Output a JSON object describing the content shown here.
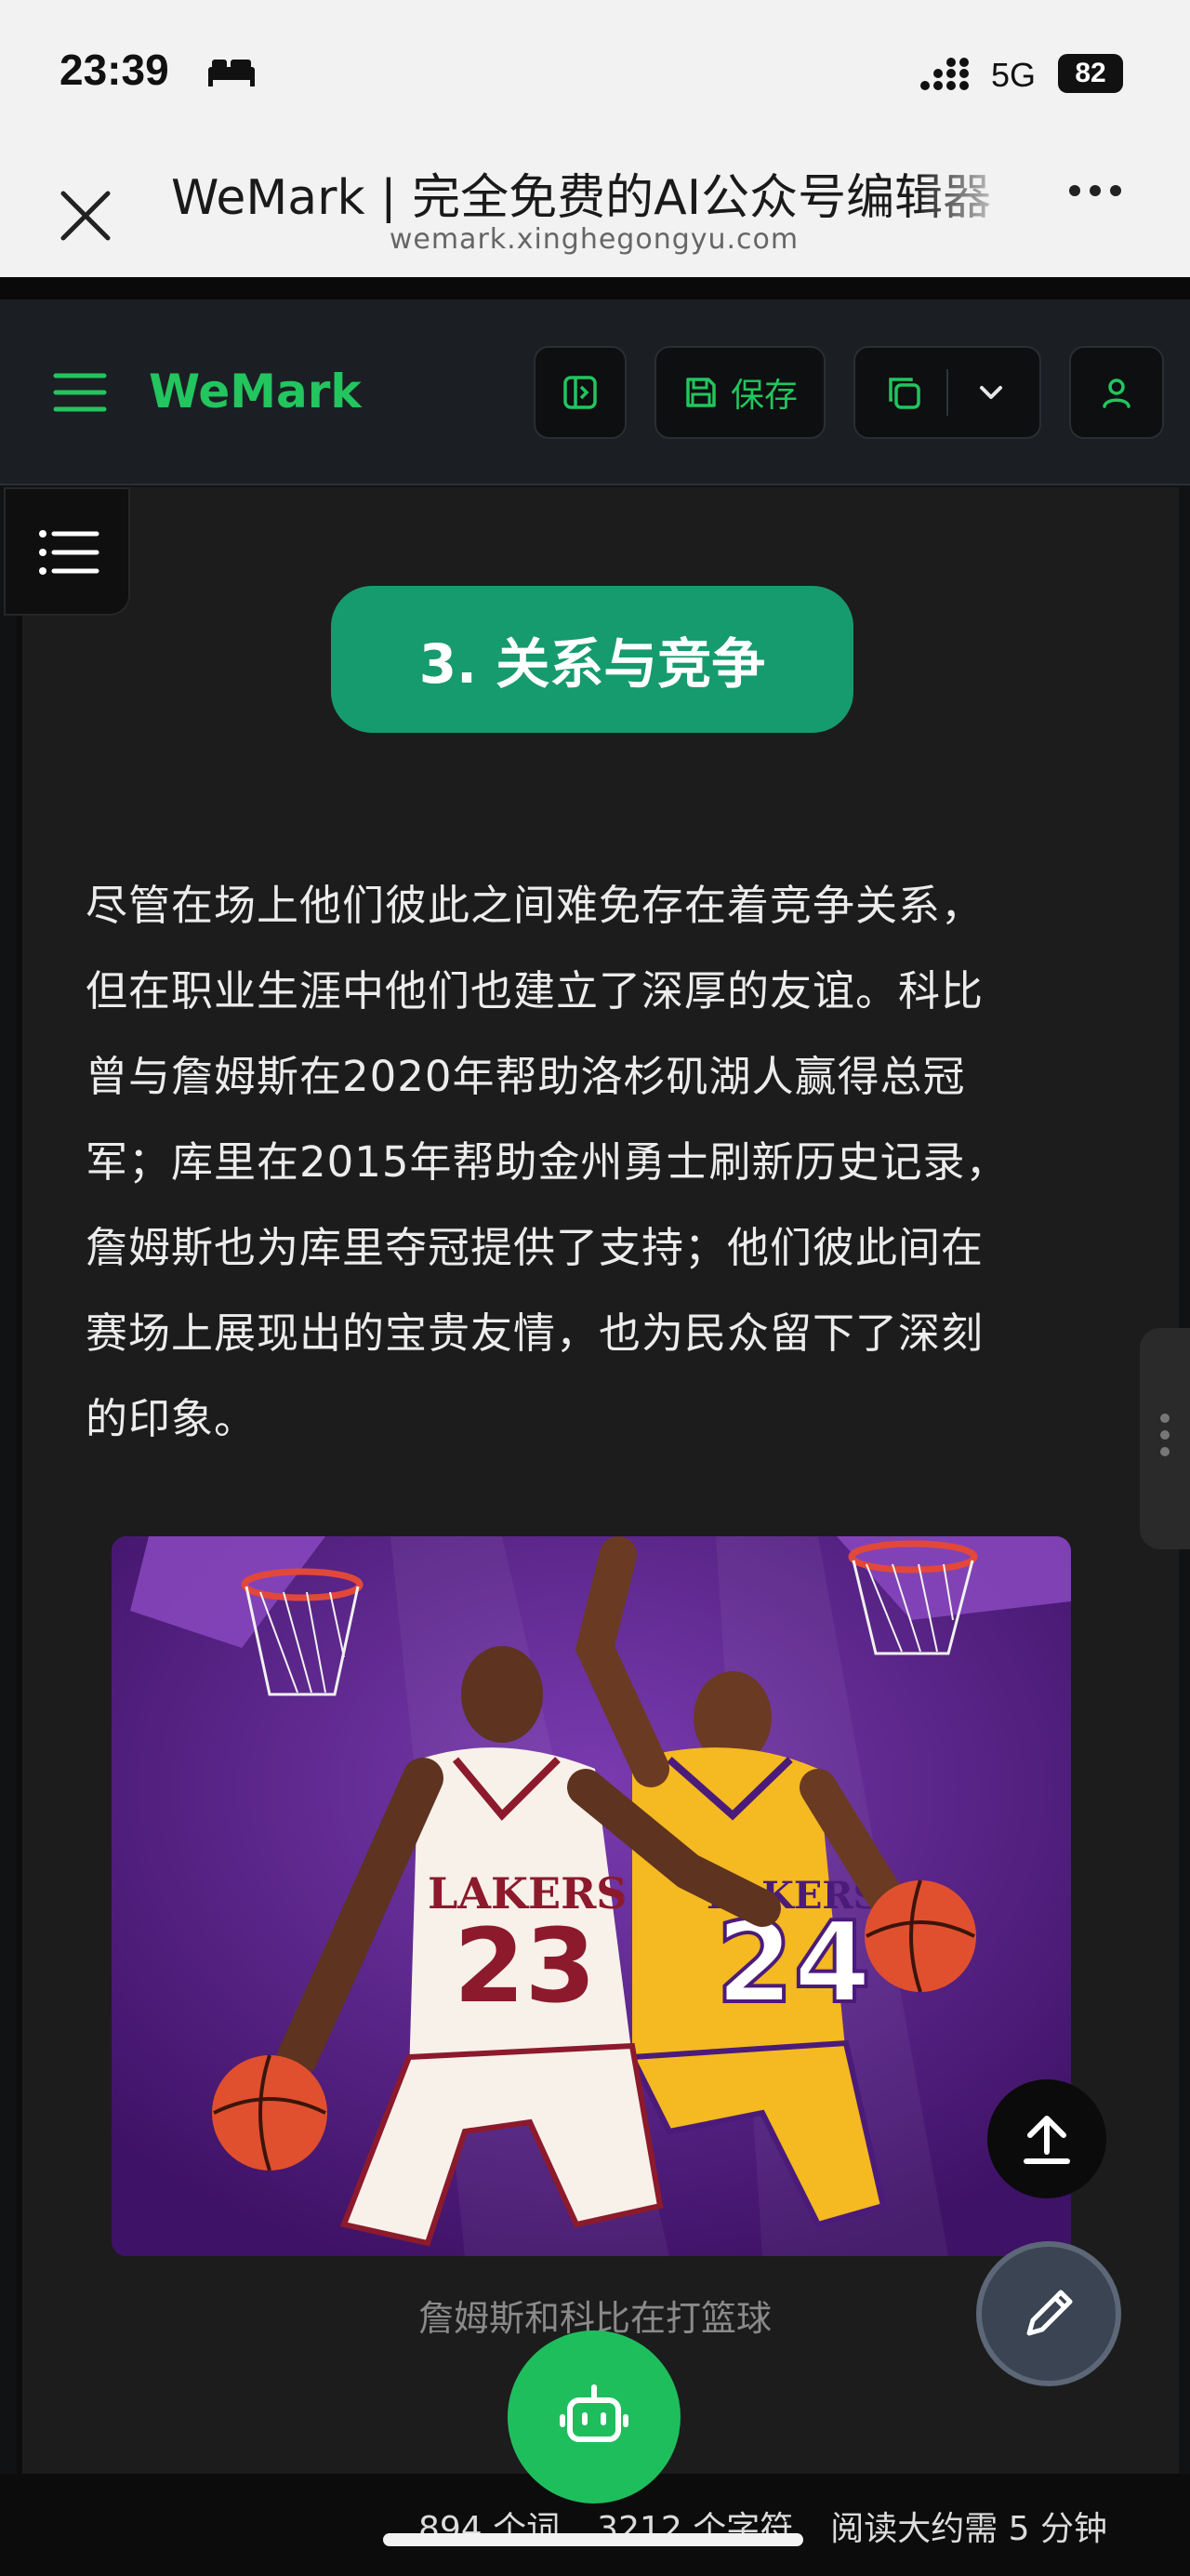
{
  "status_bar": {
    "time": "23:39",
    "network": "5G",
    "battery": "82"
  },
  "browser": {
    "page_title": "WeMark | 完全免费的AI公众号编辑器",
    "url": "wemark.xinghegongyu.com"
  },
  "app": {
    "brand": "WeMark",
    "save_label": "保存",
    "accent_color": "#22c55e"
  },
  "article": {
    "section_heading": "3. 关系与竞争",
    "lines": [
      "尽管在场上他们彼此之间难免存在着竞争关系，",
      "但在职业生涯中他们也建立了深厚的友谊。科比",
      "曾与詹姆斯在2020年帮助洛杉矶湖人赢得总冠",
      "军；库里在2015年帮助金州勇士刷新历史记录，",
      "詹姆斯也为库里夺冠提供了支持；他们彼此间在",
      "赛场上展现出的宝贵友情，也为民众留下了深刻",
      "的印象。"
    ],
    "image_jersey_left": "LAKERS",
    "image_number_left": "23",
    "image_jersey_right": "LAKERS",
    "image_number_right": "24",
    "image_caption": "詹姆斯和科比在打篮球"
  },
  "footer": {
    "words": "894 个词",
    "chars": "3212 个字符",
    "read_time": "阅读大约需 5 分钟"
  }
}
